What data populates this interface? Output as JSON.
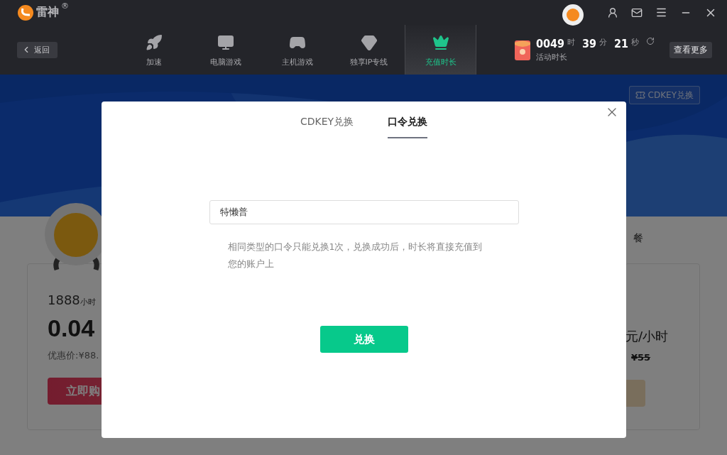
{
  "app": {
    "logo": "雷神",
    "registered": "®"
  },
  "back_button": {
    "label": "返回"
  },
  "nav": [
    {
      "label": "加速",
      "kind": "rocket",
      "selected": false
    },
    {
      "label": "电脑游戏",
      "kind": "monitor",
      "selected": false
    },
    {
      "label": "主机游戏",
      "kind": "gamepad",
      "selected": false
    },
    {
      "label": "独享IP专线",
      "kind": "gem",
      "selected": false
    },
    {
      "label": "充值时长",
      "kind": "crown",
      "selected": true
    }
  ],
  "activity_timer": {
    "hours": "0049",
    "hours_unit": "时",
    "minutes": "39",
    "minutes_unit": "分",
    "seconds": "21",
    "seconds_unit": "秒",
    "label": "活动时长"
  },
  "more_button": "查看更多",
  "background": {
    "cdkey_button": "CDKEY兑换",
    "section_heading": "餐",
    "left_card": {
      "hours": "1888",
      "hours_unit": "小时",
      "price": "0.04",
      "discount": "优惠价:¥88.",
      "buy_button": "立即购"
    },
    "right_card": {
      "unit_price": "元/小时",
      "original_price": "¥55"
    }
  },
  "dialog": {
    "tabs": [
      {
        "label": "CDKEY兑换",
        "selected": false
      },
      {
        "label": "口令兑换",
        "selected": true
      }
    ],
    "input": {
      "value": "特懒普"
    },
    "hint": "相同类型的口令只能兑换1次，兑换成功后，时长将直接充值到您的账户上",
    "submit": "兑换"
  }
}
